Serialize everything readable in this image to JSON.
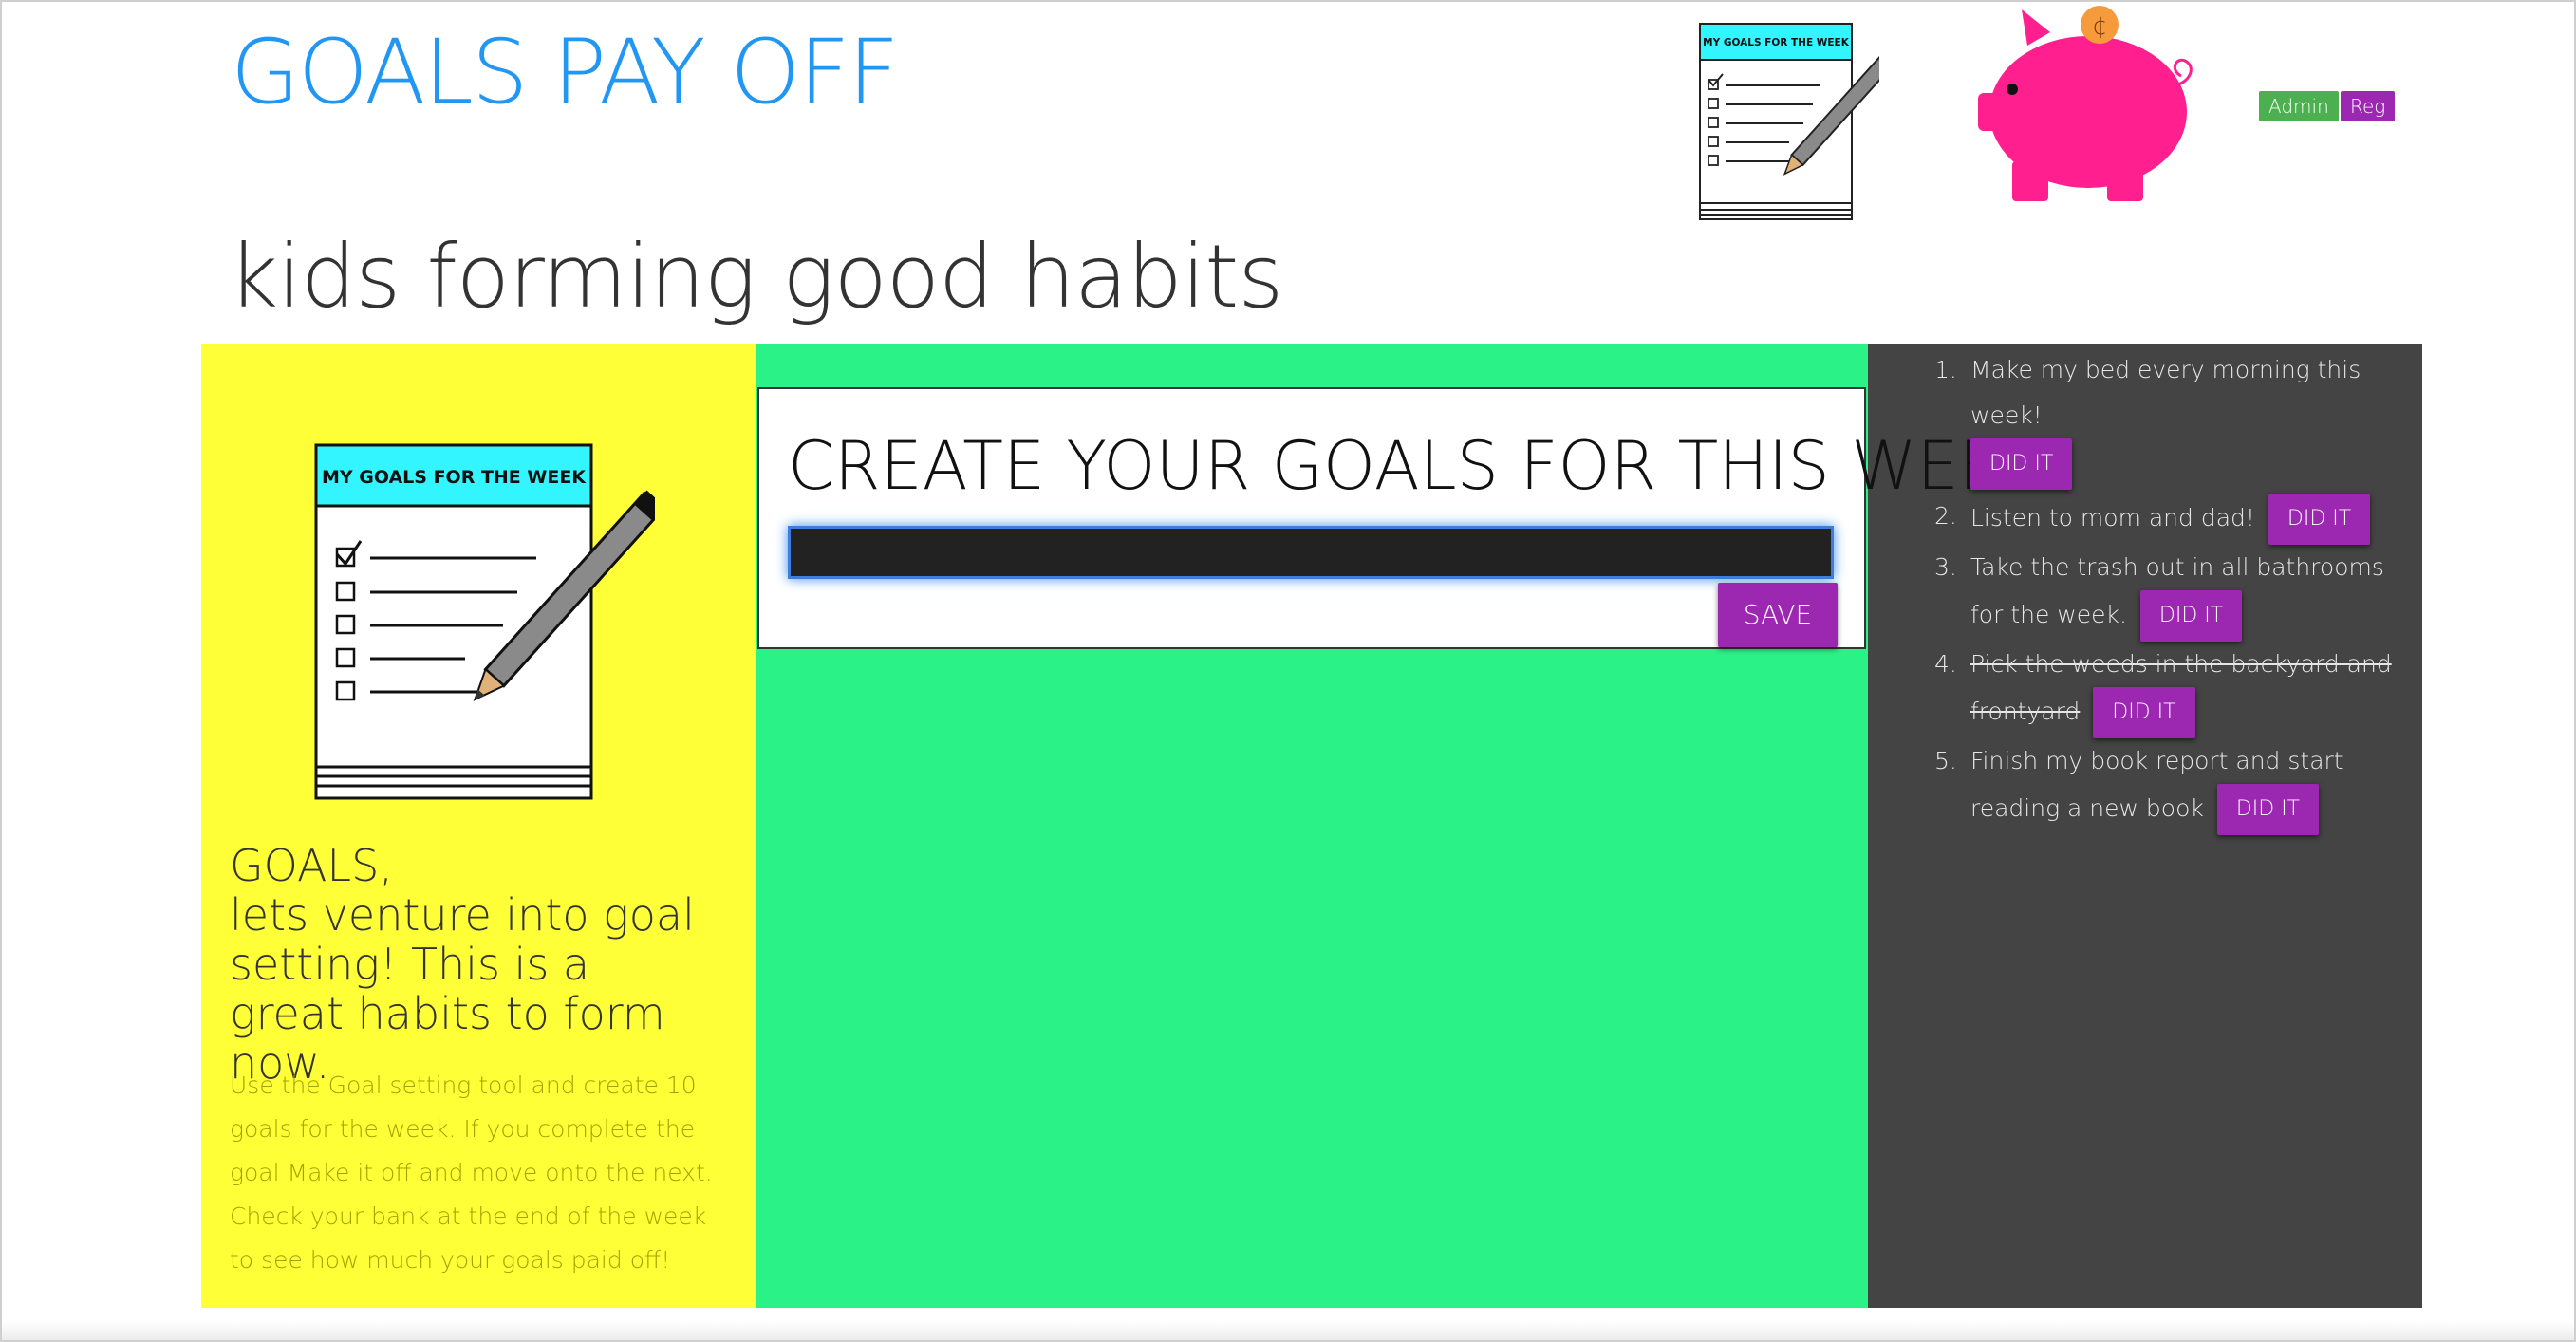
{
  "header": {
    "title": "GOALS PAY OFF",
    "tagline": "kids forming good habits",
    "notepad_label": "MY GOALS FOR THE WEEK",
    "coin_symbol": "¢",
    "admin_label": "Admin",
    "reg_label": "Reg"
  },
  "sidebar": {
    "notepad_label": "MY GOALS FOR THE WEEK",
    "heading_line1": "GOALS,",
    "heading_line2": "lets venture into goal setting! This is a great habits to form now.",
    "description": "Use the Goal setting tool and create 10 goals for the week. If you complete the goal Make it off and move onto the next. Check your bank at the end of the week to see how much your goals paid off!"
  },
  "create": {
    "title": "CREATE YOUR GOALS FOR THIS WEEK",
    "input_value": "",
    "save_label": "SAVE"
  },
  "goals": [
    {
      "num": "1.",
      "text": "Make my bed every morning this week!",
      "button": "DID IT",
      "done": false
    },
    {
      "num": "2.",
      "text": "Listen to mom and dad!",
      "button": "DID IT",
      "done": false
    },
    {
      "num": "3.",
      "text": "Take the trash out in all bathrooms for the week.",
      "button": "DID IT",
      "done": false
    },
    {
      "num": "4.",
      "text": "Pick the weeds in the backyard and frontyard",
      "button": "DID IT",
      "done": true
    },
    {
      "num": "5.",
      "text": "Finish my book report and start reading a new book",
      "button": "DID IT",
      "done": false
    }
  ],
  "colors": {
    "title_blue": "#2196f3",
    "yellow": "#ffff38",
    "green": "#2af287",
    "dark": "#444444",
    "purple": "#9c27b0",
    "pig_pink": "#ff1f8e",
    "coin_orange": "#f59b3c",
    "notepad_header": "#33f5ff",
    "admin_green": "#4caf50"
  }
}
